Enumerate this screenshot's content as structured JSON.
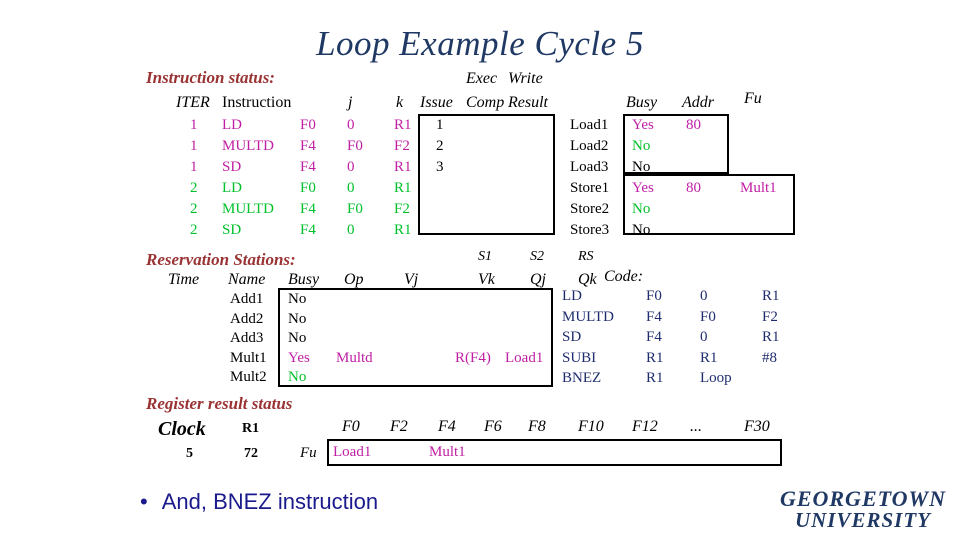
{
  "title": "Loop Example Cycle 5",
  "sections": {
    "instruction_status": "Instruction status:",
    "reservation_stations": "Reservation Stations:",
    "register_result_status": "Register result status",
    "code": "Code:"
  },
  "instruction_table": {
    "headers": {
      "iter": "ITER",
      "instruction": "Instruction",
      "j": "j",
      "k": "k",
      "exec": "Exec",
      "write": "Write",
      "issue": "Issue",
      "comp": "Comp",
      "result": "Result"
    },
    "rows": [
      {
        "iter": "1",
        "op": "LD",
        "dest": "F0",
        "j": "0",
        "k": "R1",
        "issue": "1",
        "comp": "",
        "result": "",
        "color": "magenta"
      },
      {
        "iter": "1",
        "op": "MULTD",
        "dest": "F4",
        "j": "F0",
        "k": "F2",
        "issue": "2",
        "comp": "",
        "result": "",
        "color": "magenta"
      },
      {
        "iter": "1",
        "op": "SD",
        "dest": "F4",
        "j": "0",
        "k": "R1",
        "issue": "3",
        "comp": "",
        "result": "",
        "color": "magenta"
      },
      {
        "iter": "2",
        "op": "LD",
        "dest": "F0",
        "j": "0",
        "k": "R1",
        "issue": "",
        "comp": "",
        "result": "",
        "color": "green"
      },
      {
        "iter": "2",
        "op": "MULTD",
        "dest": "F4",
        "j": "F0",
        "k": "F2",
        "issue": "",
        "comp": "",
        "result": "",
        "color": "green"
      },
      {
        "iter": "2",
        "op": "SD",
        "dest": "F4",
        "j": "0",
        "k": "R1",
        "issue": "",
        "comp": "",
        "result": "",
        "color": "green"
      }
    ]
  },
  "functional_units": {
    "headers": {
      "busy": "Busy",
      "addr": "Addr",
      "fu": "Fu"
    },
    "rows": [
      {
        "name": "Load1",
        "busy": "Yes",
        "addr": "80",
        "fu": "",
        "color": "magenta"
      },
      {
        "name": "Load2",
        "busy": "No",
        "addr": "",
        "fu": "",
        "color": "green"
      },
      {
        "name": "Load3",
        "busy": "No",
        "addr": "",
        "fu": "",
        "color": "black"
      },
      {
        "name": "Store1",
        "busy": "Yes",
        "addr": "80",
        "fu": "Mult1",
        "color": "magenta"
      },
      {
        "name": "Store2",
        "busy": "No",
        "addr": "",
        "fu": "",
        "color": "green"
      },
      {
        "name": "Store3",
        "busy": "No",
        "addr": "",
        "fu": "",
        "color": "black"
      }
    ]
  },
  "reservation_stations": {
    "headers": {
      "time": "Time",
      "name": "Name",
      "busy": "Busy",
      "op": "Op",
      "vj": "Vj",
      "vk": "Vk",
      "qj": "Qj",
      "qk": "Qk",
      "s1": "S1",
      "s2": "S2",
      "rs": "RS"
    },
    "rows": [
      {
        "time": "",
        "name": "Add1",
        "busy": "No",
        "op": "",
        "vj": "",
        "vk": "",
        "qj": "",
        "qk": "",
        "color": "black"
      },
      {
        "time": "",
        "name": "Add2",
        "busy": "No",
        "op": "",
        "vj": "",
        "vk": "",
        "qj": "",
        "qk": "",
        "color": "black"
      },
      {
        "time": "",
        "name": "Add3",
        "busy": "No",
        "op": "",
        "vj": "",
        "vk": "",
        "qj": "",
        "qk": "",
        "color": "black"
      },
      {
        "time": "",
        "name": "Mult1",
        "busy": "Yes",
        "op": "Multd",
        "vj": "",
        "vk": "R(F4)",
        "qj": "Load1",
        "qk": "",
        "color": "magenta"
      },
      {
        "time": "",
        "name": "Mult2",
        "busy": "No",
        "op": "",
        "vj": "",
        "vk": "",
        "qj": "",
        "qk": "",
        "color": "green"
      }
    ]
  },
  "code": {
    "lines": [
      {
        "op": "LD",
        "a": "F0",
        "b": "0",
        "c": "R1"
      },
      {
        "op": "MULTD",
        "a": "F4",
        "b": "F0",
        "c": "F2"
      },
      {
        "op": "SD",
        "a": "F4",
        "b": "0",
        "c": "R1"
      },
      {
        "op": "SUBI",
        "a": "R1",
        "b": "R1",
        "c": "#8"
      },
      {
        "op": "BNEZ",
        "a": "R1",
        "b": "Loop",
        "c": ""
      }
    ]
  },
  "register_status": {
    "clock_label": "Clock",
    "clock_value": "5",
    "r1_label": "R1",
    "r1_value": "72",
    "fu_label": "Fu",
    "columns": [
      "F0",
      "F2",
      "F4",
      "F6",
      "F8",
      "F10",
      "F12",
      "...",
      "F30"
    ],
    "values": [
      {
        "reg": "F0",
        "fu": "Load1",
        "color": "magenta"
      },
      {
        "reg": "F2",
        "fu": "",
        "color": "black"
      },
      {
        "reg": "F4",
        "fu": "Mult1",
        "color": "magenta"
      },
      {
        "reg": "F6",
        "fu": "",
        "color": "black"
      },
      {
        "reg": "F8",
        "fu": "",
        "color": "black"
      },
      {
        "reg": "F10",
        "fu": "",
        "color": "black"
      },
      {
        "reg": "F12",
        "fu": "",
        "color": "black"
      },
      {
        "reg": "...",
        "fu": "",
        "color": "black"
      },
      {
        "reg": "F30",
        "fu": "",
        "color": "black"
      }
    ]
  },
  "bullet": {
    "marker": "•",
    "text": "And, BNEZ instruction"
  },
  "logo": {
    "line1": "GEORGETOWN",
    "line2": "UNIVERSITY"
  },
  "colors": {
    "title": "#1f3864",
    "heading_red": "#9a3334",
    "magenta": "#c01fa4",
    "green": "#00c02b",
    "navy": "#1f2d6e",
    "bullet_blue": "#1a1a8c",
    "background": "#ffffff"
  }
}
